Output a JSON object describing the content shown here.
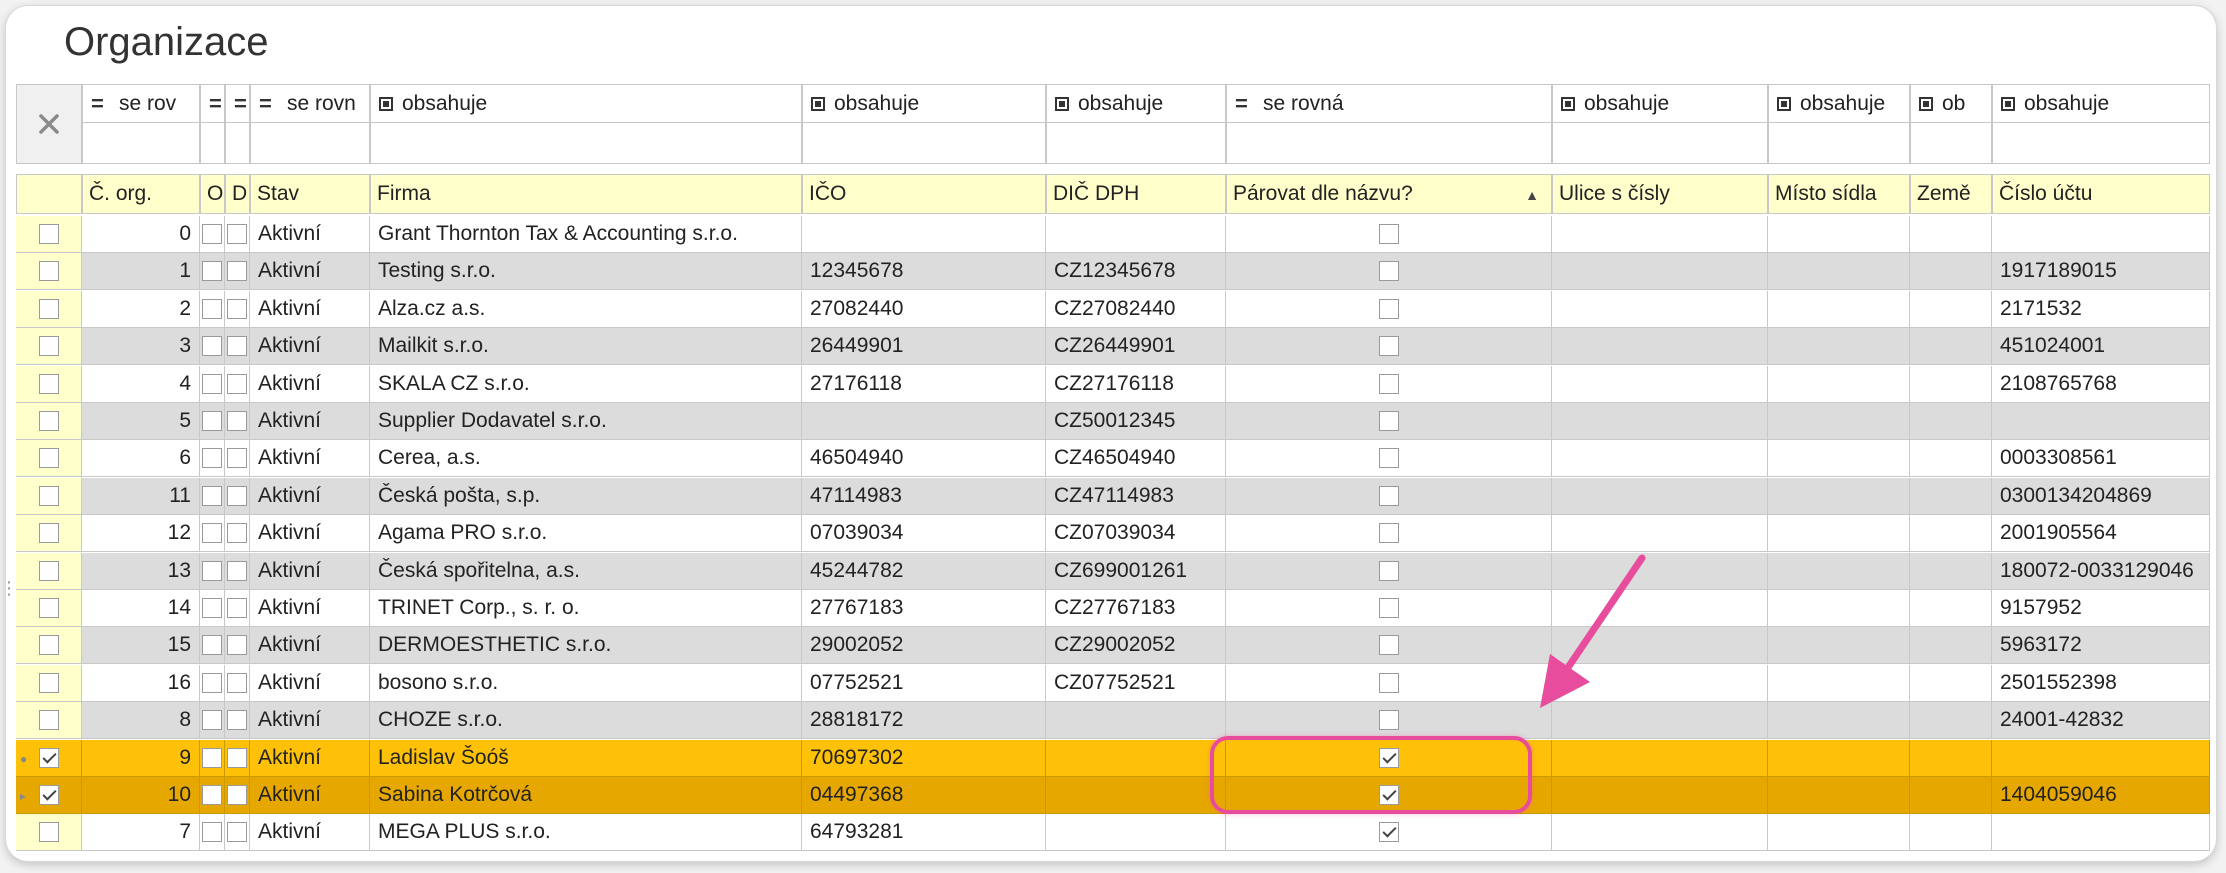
{
  "title": "Organizace",
  "filters": [
    {
      "op": "=",
      "text": "se rov"
    },
    {
      "op": "=",
      "text": ""
    },
    {
      "op": "=",
      "text": ""
    },
    {
      "op": "=",
      "text": "se rovn"
    },
    {
      "op": "box",
      "text": "obsahuje"
    },
    {
      "op": "box",
      "text": "obsahuje"
    },
    {
      "op": "box",
      "text": "obsahuje"
    },
    {
      "op": "=",
      "text": "se rovná"
    },
    {
      "op": "box",
      "text": "obsahuje"
    },
    {
      "op": "box",
      "text": "obsahuje"
    },
    {
      "op": "box",
      "text": "ob"
    },
    {
      "op": "box",
      "text": "obsahuje"
    }
  ],
  "columns": [
    "Č. org.",
    "O",
    "D",
    "Stav",
    "Firma",
    "IČO",
    "DIČ DPH",
    "Párovat dle názvu?",
    "Ulice s čísly",
    "Místo sídla",
    "Země",
    "Číslo účtu"
  ],
  "rows": [
    {
      "org": "0",
      "status": "Aktivní",
      "firma": "Grant Thornton Tax & Accounting s.r.o.",
      "ico": "",
      "dic": "",
      "sel": false,
      "par": false,
      "ucet": ""
    },
    {
      "org": "1",
      "status": "Aktivní",
      "firma": "Testing s.r.o.",
      "ico": "12345678",
      "dic": "CZ12345678",
      "sel": false,
      "par": false,
      "ucet": "1917189015"
    },
    {
      "org": "2",
      "status": "Aktivní",
      "firma": "Alza.cz a.s.",
      "ico": "27082440",
      "dic": "CZ27082440",
      "sel": false,
      "par": false,
      "ucet": "2171532"
    },
    {
      "org": "3",
      "status": "Aktivní",
      "firma": "Mailkit s.r.o.",
      "ico": "26449901",
      "dic": "CZ26449901",
      "sel": false,
      "par": false,
      "ucet": "451024001"
    },
    {
      "org": "4",
      "status": "Aktivní",
      "firma": "SKALA CZ s.r.o.",
      "ico": "27176118",
      "dic": "CZ27176118",
      "sel": false,
      "par": false,
      "ucet": "2108765768"
    },
    {
      "org": "5",
      "status": "Aktivní",
      "firma": "Supplier Dodavatel s.r.o.",
      "ico": "",
      "dic": "CZ50012345",
      "sel": false,
      "par": false,
      "ucet": ""
    },
    {
      "org": "6",
      "status": "Aktivní",
      "firma": "Cerea, a.s.",
      "ico": "46504940",
      "dic": "CZ46504940",
      "sel": false,
      "par": false,
      "ucet": "0003308561"
    },
    {
      "org": "11",
      "status": "Aktivní",
      "firma": "Česká pošta, s.p.",
      "ico": "47114983",
      "dic": "CZ47114983",
      "sel": false,
      "par": false,
      "ucet": "0300134204869"
    },
    {
      "org": "12",
      "status": "Aktivní",
      "firma": "Agama PRO s.r.o.",
      "ico": "07039034",
      "dic": "CZ07039034",
      "sel": false,
      "par": false,
      "ucet": "2001905564"
    },
    {
      "org": "13",
      "status": "Aktivní",
      "firma": "Česká spořitelna, a.s.",
      "ico": "45244782",
      "dic": "CZ699001261",
      "sel": false,
      "par": false,
      "ucet": "180072-0033129046"
    },
    {
      "org": "14",
      "status": "Aktivní",
      "firma": "TRINET Corp., s. r. o.",
      "ico": "27767183",
      "dic": "CZ27767183",
      "sel": false,
      "par": false,
      "ucet": "9157952"
    },
    {
      "org": "15",
      "status": "Aktivní",
      "firma": "DERMOESTHETIC s.r.o.",
      "ico": "29002052",
      "dic": "CZ29002052",
      "sel": false,
      "par": false,
      "ucet": "5963172"
    },
    {
      "org": "16",
      "status": "Aktivní",
      "firma": "bosono s.r.o.",
      "ico": "07752521",
      "dic": "CZ07752521",
      "sel": false,
      "par": false,
      "ucet": "2501552398"
    },
    {
      "org": "8",
      "status": "Aktivní",
      "firma": "CHOZE s.r.o.",
      "ico": "28818172",
      "dic": "",
      "sel": false,
      "par": false,
      "ucet": "24001-42832"
    },
    {
      "org": "9",
      "status": "Aktivní",
      "firma": "Ladislav Šoóš",
      "ico": "70697302",
      "dic": "",
      "sel": true,
      "par": true,
      "ucet": "",
      "highlight": "sel1"
    },
    {
      "org": "10",
      "status": "Aktivní",
      "firma": "Sabina Kotrčová",
      "ico": "04497368",
      "dic": "",
      "sel": true,
      "par": true,
      "ucet": "1404059046",
      "highlight": "sel2"
    },
    {
      "org": "7",
      "status": "Aktivní",
      "firma": "MEGA PLUS s.r.o.",
      "ico": "64793281",
      "dic": "",
      "sel": false,
      "par": true,
      "ucet": ""
    }
  ],
  "colors": {
    "header_bg": "#ffffcc",
    "row_alt": "#dcdcdc",
    "selected": "#ffc107",
    "selected_active": "#e6a800",
    "annotation": "#e84c9c"
  },
  "icons": {
    "clear_filter": "close-icon",
    "sort": "sort-ascending-icon",
    "arrow": "annotation-arrow-icon"
  }
}
